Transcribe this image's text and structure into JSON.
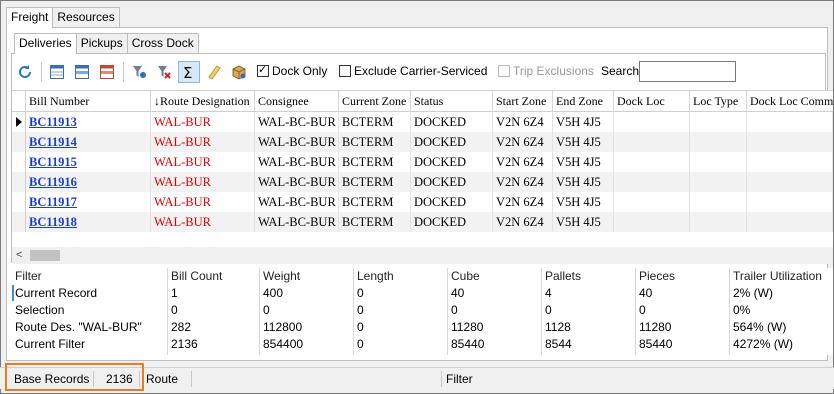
{
  "top_tabs": [
    "Freight",
    "Resources"
  ],
  "sub_tabs": [
    "Deliveries",
    "Pickups",
    "Cross Dock"
  ],
  "toolbar": {
    "icons": [
      "refresh-icon",
      "layout-normal-icon",
      "layout-blue-icon",
      "layout-red-icon",
      "filter-icon",
      "clear-filter-icon",
      "sum-icon",
      "note-icon",
      "box-icon"
    ]
  },
  "options": {
    "dock_only": "Dock Only",
    "exclude_carrier": "Exclude Carrier-Serviced",
    "trip_exclusions": "Trip Exclusions",
    "search_label": "Search",
    "search_value": ""
  },
  "grid": {
    "columns": [
      "Bill Number",
      "Route Designation",
      "Consignee",
      "Current Zone",
      "Status",
      "Start Zone",
      "End Zone",
      "Dock Loc",
      "Loc Type",
      "Dock Loc Comm"
    ],
    "sort_indicator": "↓",
    "rows": [
      [
        "BC11913",
        "WAL-BUR",
        "WAL-BC-BUR",
        "BCTERM",
        "DOCKED",
        "V2N 6Z4",
        "V5H 4J5",
        "",
        "",
        ""
      ],
      [
        "BC11914",
        "WAL-BUR",
        "WAL-BC-BUR",
        "BCTERM",
        "DOCKED",
        "V2N 6Z4",
        "V5H 4J5",
        "",
        "",
        ""
      ],
      [
        "BC11915",
        "WAL-BUR",
        "WAL-BC-BUR",
        "BCTERM",
        "DOCKED",
        "V2N 6Z4",
        "V5H 4J5",
        "",
        "",
        ""
      ],
      [
        "BC11916",
        "WAL-BUR",
        "WAL-BC-BUR",
        "BCTERM",
        "DOCKED",
        "V2N 6Z4",
        "V5H 4J5",
        "",
        "",
        ""
      ],
      [
        "BC11917",
        "WAL-BUR",
        "WAL-BC-BUR",
        "BCTERM",
        "DOCKED",
        "V2N 6Z4",
        "V5H 4J5",
        "",
        "",
        ""
      ],
      [
        "BC11918",
        "WAL-BUR",
        "WAL-BC-BUR",
        "BCTERM",
        "DOCKED",
        "V2N 6Z4",
        "V5H 4J5",
        "",
        "",
        ""
      ]
    ]
  },
  "summary": {
    "columns": [
      "Filter",
      "Bill Count",
      "Weight",
      "Length",
      "Cube",
      "Pallets",
      "Pieces",
      "Trailer Utilization"
    ],
    "rows": [
      [
        "Current Record",
        "1",
        "400",
        "0",
        "40",
        "4",
        "40",
        "2% (W)"
      ],
      [
        "Selection",
        "0",
        "0",
        "0",
        "0",
        "0",
        "0",
        "0%"
      ],
      [
        "Route Des. \"WAL-BUR\"",
        "282",
        "112800",
        "0",
        "11280",
        "1128",
        "11280",
        "564% (W)"
      ],
      [
        "Current Filter",
        "2136",
        "854400",
        "0",
        "85440",
        "8544",
        "85440",
        "4272% (W)"
      ]
    ]
  },
  "status": {
    "base_records_label": "Base Records",
    "base_records_value": "2136",
    "route_label": "Route",
    "filter_label": "Filter"
  },
  "colors": {
    "link": "#1a3fd0",
    "route": "#e00000",
    "highlight": "#e67e22"
  }
}
